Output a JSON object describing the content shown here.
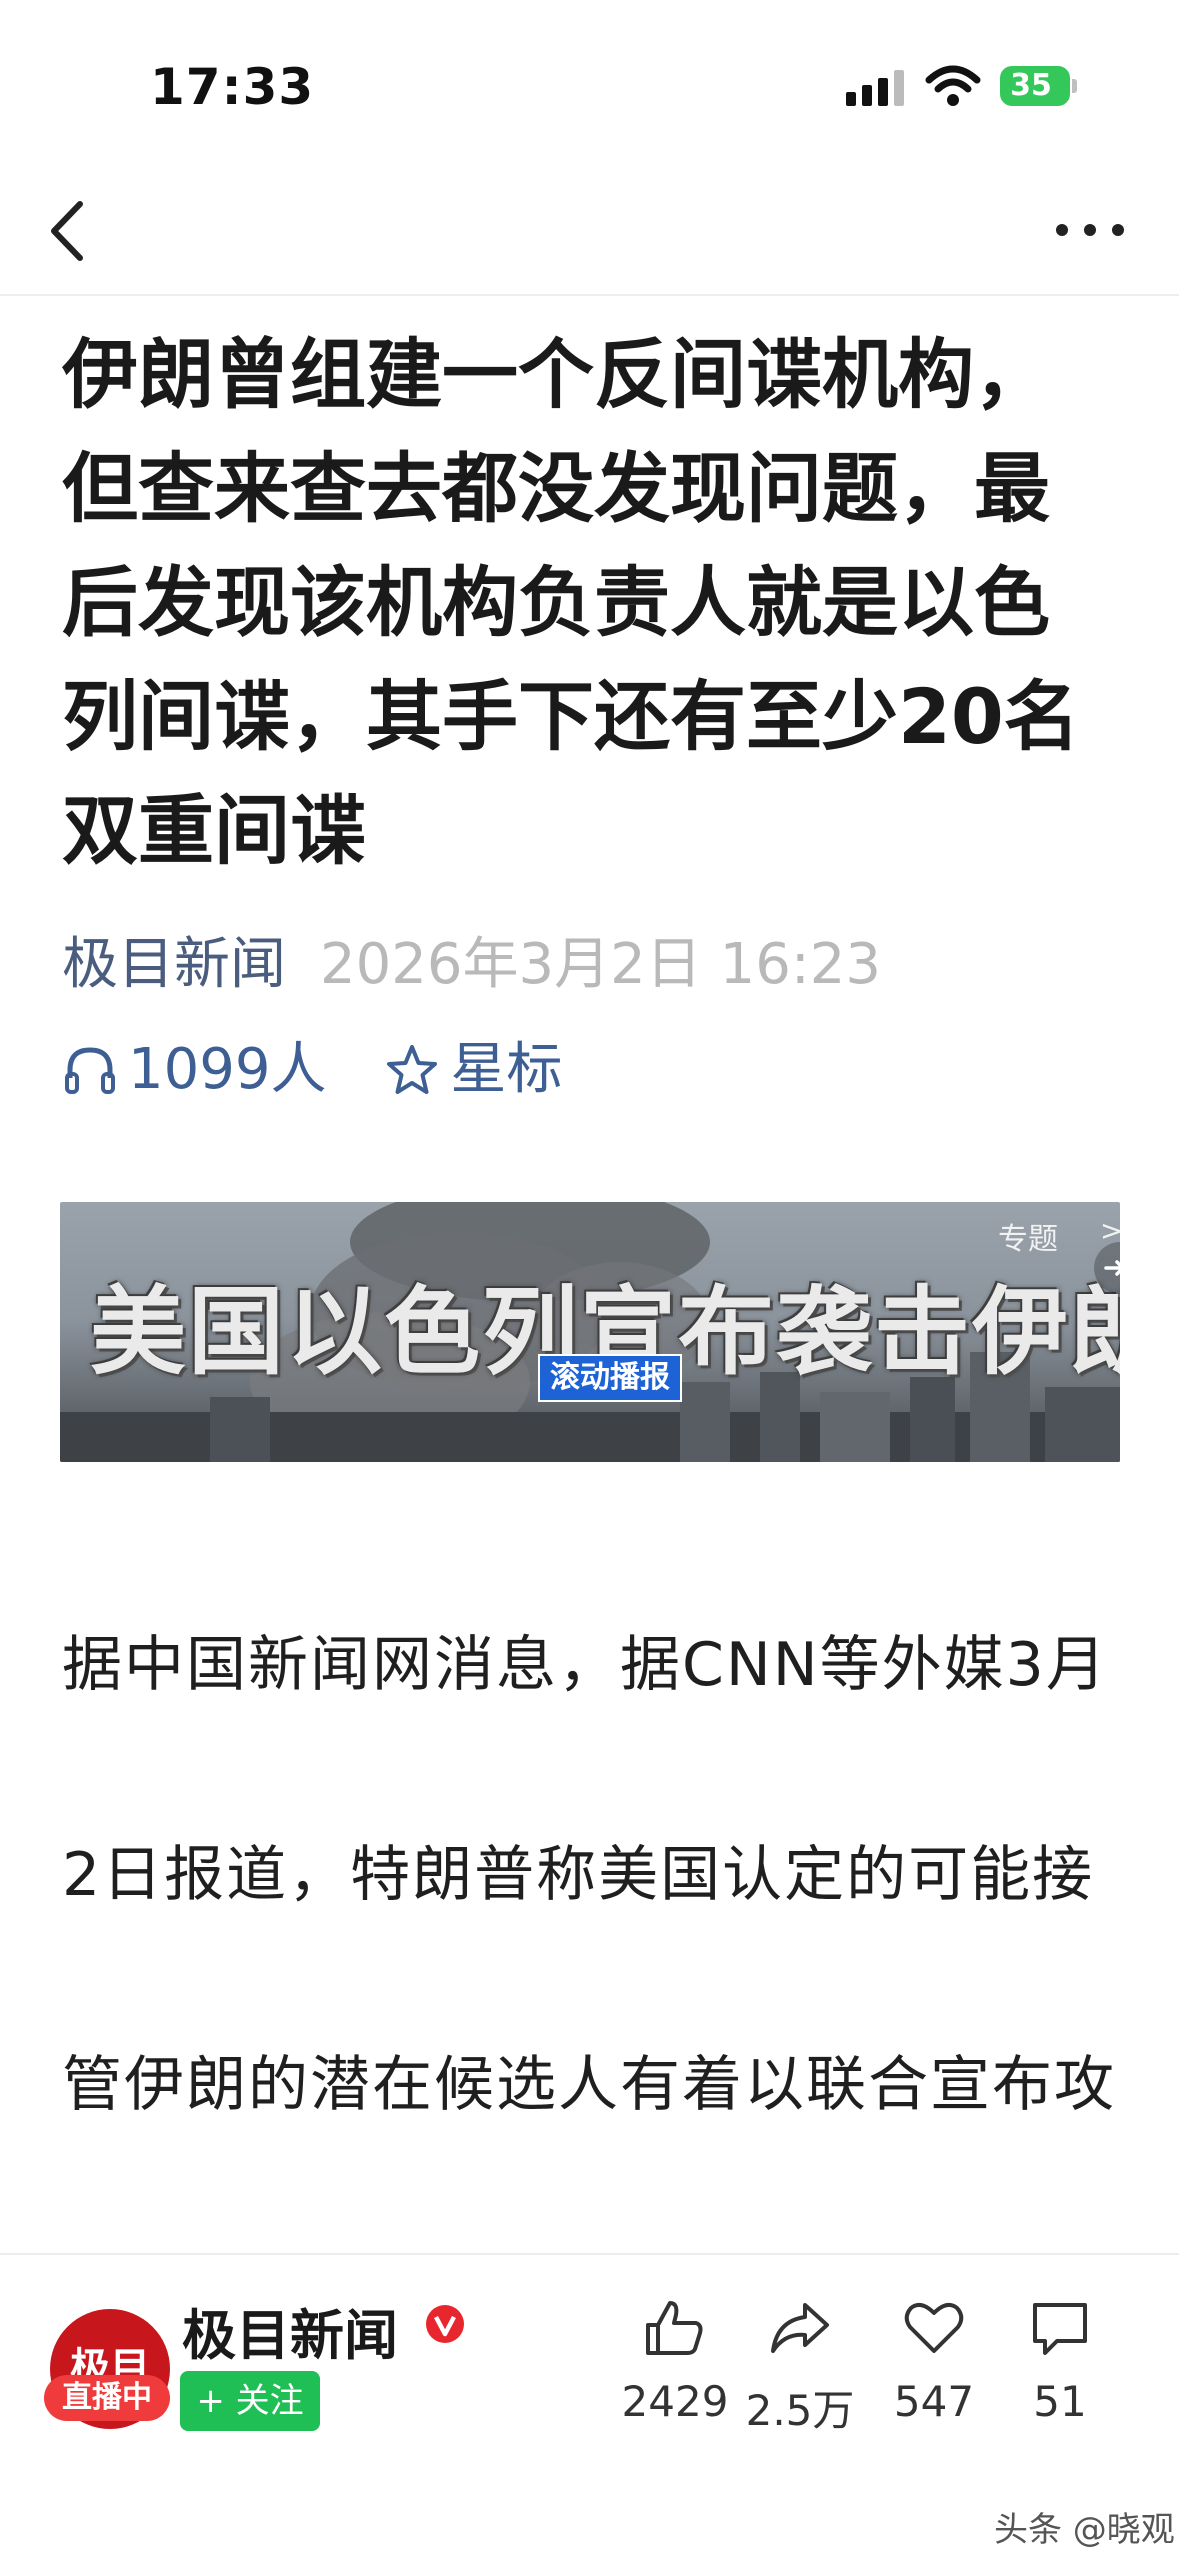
{
  "status_bar": {
    "time": "17:33",
    "battery": "35"
  },
  "article": {
    "title": "伊朗曾组建一个反间谍机构，但查来查去都没发现问题，最后发现该机构负责人就是以色列间谍，其手下还有至少20名双重间谍",
    "source": "极目新闻",
    "publish_time": "2026年3月2日 16:23",
    "listeners": "1099人",
    "star_label": "星标",
    "body": "据中国新闻网消息，据CNN等外媒3月2日报道，特朗普称美国认定的可能接管伊朗的潜在候选人有着以联合宣布攻击，特朗"
  },
  "banner": {
    "headline": "美国以色列宣布袭击伊朗",
    "tag": "滚动播报",
    "topic_label": "专题",
    "topic_arrows": ">>>"
  },
  "bottom_bar": {
    "avatar_text": "极目",
    "live_label": "直播中",
    "account_name": "极目新闻",
    "follow_label": "+ 关注",
    "likes": "2429",
    "shares": "2.5万",
    "favorites": "547",
    "comments": "51"
  },
  "watermark": "头条 @晓观",
  "colors": {
    "accent_green": "#1fbf56",
    "live_red": "#ef3b3b",
    "link_blue": "#3e5f93",
    "banner_tag_blue": "#1e63d6"
  }
}
